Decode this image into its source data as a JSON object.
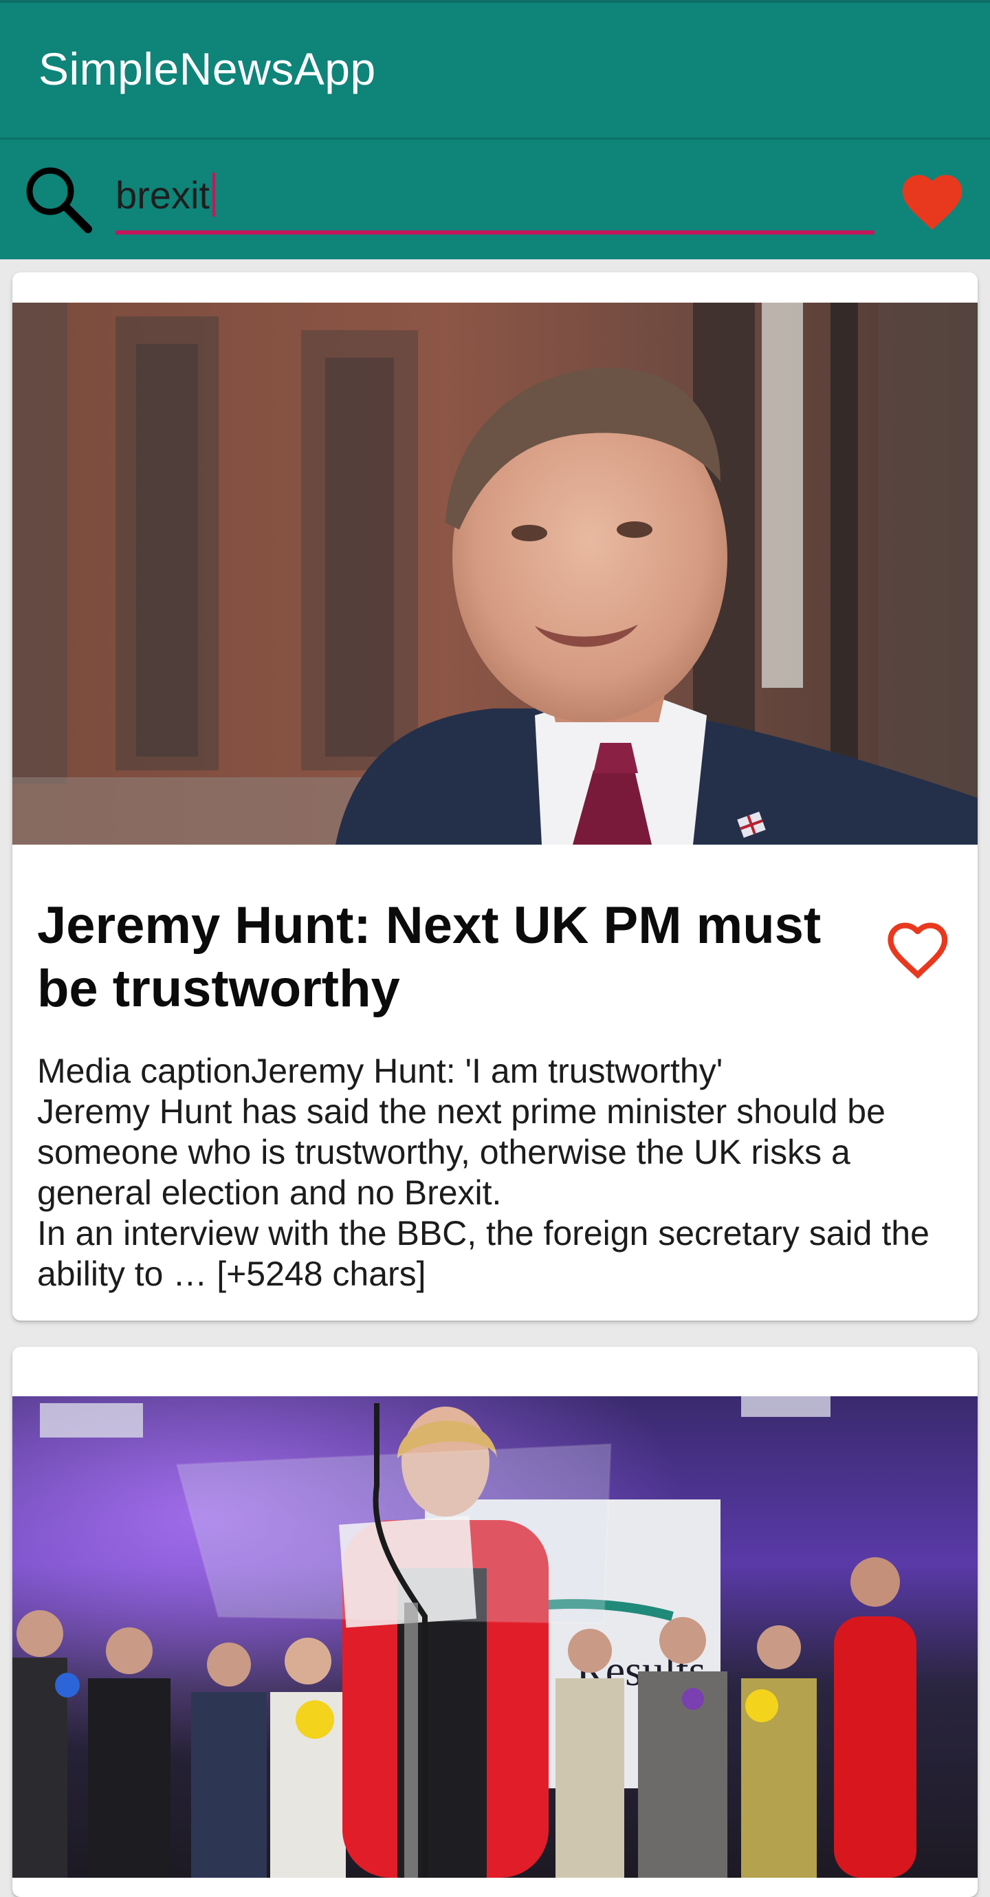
{
  "app": {
    "title": "SimpleNewsApp"
  },
  "search": {
    "value": "brexit",
    "icon": "search-icon",
    "favorites_icon": "heart-filled-icon"
  },
  "colors": {
    "primary": "#0f8479",
    "accent": "#c2185b",
    "heart": "#e8391f"
  },
  "articles": [
    {
      "title": "Jeremy Hunt: Next UK PM must be trustworthy",
      "description": "Media captionJeremy Hunt: 'I am trustworthy'\nJeremy Hunt has said the next prime minister should be someone who is trustworthy, otherwise the UK risks a general election and no Brexit.\nIn an interview with the BBC, the foreign secretary said the ability to … [+5248 chars]",
      "favorited": false,
      "favorite_icon": "heart-outline-icon"
    },
    {
      "title": "",
      "description": "",
      "favorited": false
    }
  ]
}
